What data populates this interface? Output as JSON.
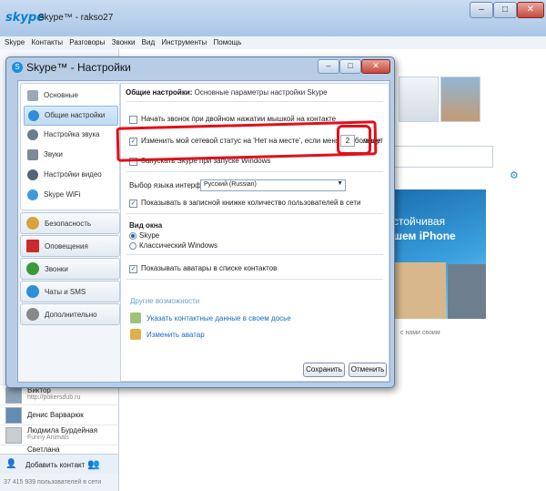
{
  "main": {
    "logo": "skype",
    "title": "Skype™ - rakso27",
    "menu": [
      "Skype",
      "Контакты",
      "Разговоры",
      "Звонки",
      "Вид",
      "Инструменты",
      "Помощь"
    ],
    "contacts": [
      {
        "name": "Виктор",
        "sub": "http://pokersdub.ru"
      },
      {
        "name": "Денис Варварюк",
        "sub": ""
      },
      {
        "name": "Людмила Бурдейная",
        "sub": "Funny Animals"
      },
      {
        "name": "Светлана",
        "sub": ""
      }
    ],
    "add_contact": "Добавить контакт",
    "status_count": "37 415 939 пользователей в сети",
    "ad": {
      "line1": "стойчивая",
      "line2": "шем iPhone"
    },
    "caption": "с нами своим"
  },
  "dialog": {
    "title": "Skype™ - Настройки",
    "nav": {
      "group1": [
        {
          "label": "Основные",
          "icon": "user-icon"
        },
        {
          "label": "Общие настройки",
          "icon": "settings-icon",
          "selected": true
        },
        {
          "label": "Настройка звука",
          "icon": "headset-icon"
        },
        {
          "label": "Звуки",
          "icon": "speaker-icon"
        },
        {
          "label": "Настройки видео",
          "icon": "camera-icon"
        },
        {
          "label": "Skype WiFi",
          "icon": "wifi-icon"
        }
      ],
      "others": [
        {
          "label": "Безопасность",
          "icon": "lock-icon",
          "color": "#d9a33b"
        },
        {
          "label": "Оповещения",
          "icon": "flag-icon",
          "color": "#cc2b2b"
        },
        {
          "label": "Звонки",
          "icon": "phone-icon",
          "color": "#3a9a3a"
        },
        {
          "label": "Чаты и SMS",
          "icon": "chat-icon",
          "color": "#2f8fd6"
        },
        {
          "label": "Дополнительно",
          "icon": "gear-icon",
          "color": "#888888"
        }
      ]
    },
    "header_bold": "Общие настройки:",
    "header_rest": " Основные параметры настройки Skype",
    "options": {
      "double_click": "Начать звонок при двойном нажатии мышкой на контакте",
      "away_status": "Изменить мой сетевой статус на 'Нет на месте', если меня нет больше",
      "away_minutes": "2",
      "minutes_unit": "минут",
      "launch_startup": "Запускать Skype при запуске Windows",
      "language_label": "Выбор языка интерфейса",
      "language_value": "Русский (Russian)",
      "show_online_count": "Показывать в записной книжке количество пользователей в сети",
      "window_view_label": "Вид окна",
      "view_skype": "Skype",
      "view_classic": "Классический Windows",
      "show_avatars": "Показывать аватары в списке контактов"
    },
    "more_label": "Другие возможности",
    "link_contact": "Указать контактные данные в своем досье",
    "link_avatar": "Изменить аватар",
    "save_label": "Сохранить",
    "cancel_label": "Отменить"
  },
  "colors": {
    "accent": "#1b8ee0",
    "annotation": "#e0101a"
  }
}
